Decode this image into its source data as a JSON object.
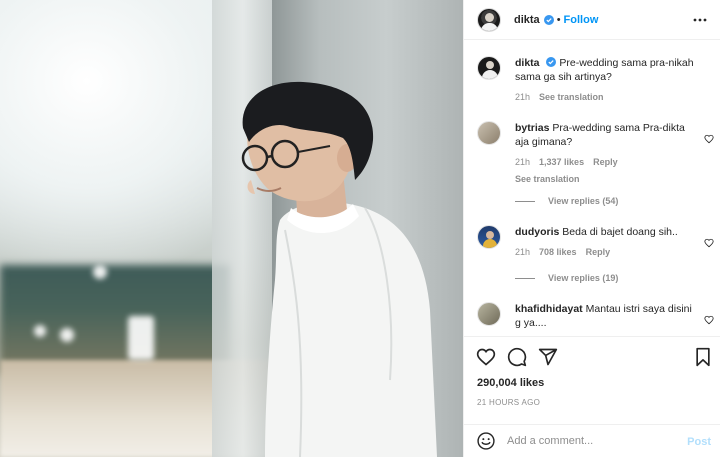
{
  "header": {
    "username": "dikta",
    "separator": "•",
    "follow_label": "Follow",
    "avatar_icon": "profile-avatar",
    "more_icon": "more-horizontal-icon"
  },
  "caption": {
    "username": "dikta",
    "text": "Pre-wedding sama pra-nikah sama ga sih artinya?",
    "time": "21h",
    "see_translation": "See translation"
  },
  "comments": [
    {
      "username": "bytrias",
      "text": "Pra-wedding sama Pra-dikta aja gimana?",
      "time": "21h",
      "likes": "1,337 likes",
      "reply": "Reply",
      "see_translation": "See translation",
      "view_replies": "View replies (54)"
    },
    {
      "username": "dudyoris",
      "text": "Beda di bajet doang sih..",
      "time": "21h",
      "likes": "708 likes",
      "reply": "Reply",
      "view_replies": "View replies (19)"
    },
    {
      "username": "khafidhidayat",
      "text": "Mantau istri saya disini g ya...."
    }
  ],
  "actions": {
    "like_icon": "heart-icon",
    "comment_icon": "comment-icon",
    "share_icon": "send-icon",
    "save_icon": "bookmark-icon"
  },
  "likes": "290,004 likes",
  "posted_ago": "21 HOURS AGO",
  "add_comment": {
    "placeholder": "Add a comment...",
    "post_label": "Post",
    "emoji_icon": "emoji-icon"
  },
  "colors": {
    "link_blue": "#0095f6",
    "verified_blue": "#3897f0",
    "muted_text": "#8e8e8e",
    "post_disabled": "#b2dffc"
  }
}
